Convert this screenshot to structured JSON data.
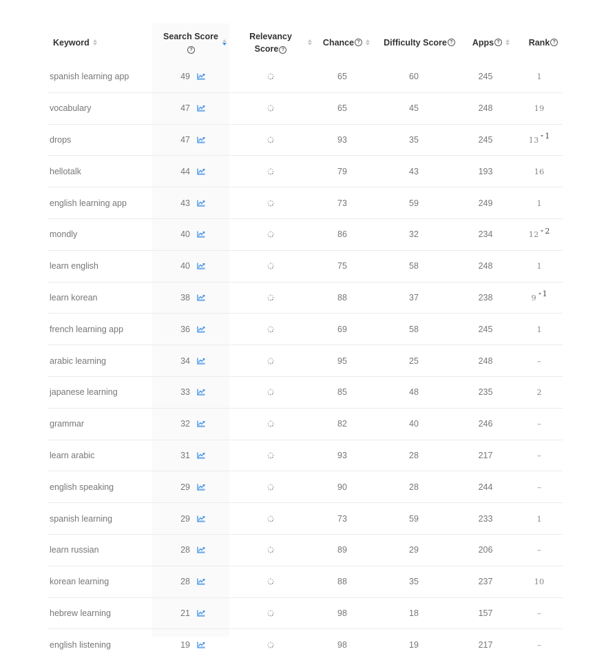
{
  "columns": {
    "keyword": "Keyword",
    "search_score": "Search Score",
    "relevancy_line1": "Relevancy",
    "relevancy_line2": "Score",
    "chance": "Chance",
    "difficulty": "Difficulty Score",
    "apps": "Apps",
    "rank": "Rank",
    "help_glyph": "?"
  },
  "colors": {
    "accent": "#3a8ee6",
    "sticky_bg": "#fafafa"
  },
  "icons": {
    "trend": "line-chart-icon",
    "relevancy": "loading-spinner-icon",
    "sort": "sort-icon",
    "help": "help-circle-icon"
  },
  "rows": [
    {
      "keyword": "spanish learning app",
      "search_score": "49",
      "chance": "65",
      "difficulty": "60",
      "apps": "245",
      "rank": "1",
      "rank_change": ""
    },
    {
      "keyword": "vocabulary",
      "search_score": "47",
      "chance": "65",
      "difficulty": "45",
      "apps": "248",
      "rank": "19",
      "rank_change": ""
    },
    {
      "keyword": "drops",
      "search_score": "47",
      "chance": "93",
      "difficulty": "35",
      "apps": "245",
      "rank": "13",
      "rank_change": "1"
    },
    {
      "keyword": "hellotalk",
      "search_score": "44",
      "chance": "79",
      "difficulty": "43",
      "apps": "193",
      "rank": "16",
      "rank_change": ""
    },
    {
      "keyword": "english learning app",
      "search_score": "43",
      "chance": "73",
      "difficulty": "59",
      "apps": "249",
      "rank": "1",
      "rank_change": ""
    },
    {
      "keyword": "mondly",
      "search_score": "40",
      "chance": "86",
      "difficulty": "32",
      "apps": "234",
      "rank": "12",
      "rank_change": "2"
    },
    {
      "keyword": "learn english",
      "search_score": "40",
      "chance": "75",
      "difficulty": "58",
      "apps": "248",
      "rank": "1",
      "rank_change": ""
    },
    {
      "keyword": "learn korean",
      "search_score": "38",
      "chance": "88",
      "difficulty": "37",
      "apps": "238",
      "rank": "9",
      "rank_change": "1"
    },
    {
      "keyword": "french learning app",
      "search_score": "36",
      "chance": "69",
      "difficulty": "58",
      "apps": "245",
      "rank": "1",
      "rank_change": ""
    },
    {
      "keyword": "arabic learning",
      "search_score": "34",
      "chance": "95",
      "difficulty": "25",
      "apps": "248",
      "rank": "–",
      "rank_change": ""
    },
    {
      "keyword": "japanese learning",
      "search_score": "33",
      "chance": "85",
      "difficulty": "48",
      "apps": "235",
      "rank": "2",
      "rank_change": ""
    },
    {
      "keyword": "grammar",
      "search_score": "32",
      "chance": "82",
      "difficulty": "40",
      "apps": "246",
      "rank": "–",
      "rank_change": ""
    },
    {
      "keyword": "learn arabic",
      "search_score": "31",
      "chance": "93",
      "difficulty": "28",
      "apps": "217",
      "rank": "–",
      "rank_change": ""
    },
    {
      "keyword": "english speaking",
      "search_score": "29",
      "chance": "90",
      "difficulty": "28",
      "apps": "244",
      "rank": "–",
      "rank_change": ""
    },
    {
      "keyword": "spanish learning",
      "search_score": "29",
      "chance": "73",
      "difficulty": "59",
      "apps": "233",
      "rank": "1",
      "rank_change": ""
    },
    {
      "keyword": "learn russian",
      "search_score": "28",
      "chance": "89",
      "difficulty": "29",
      "apps": "206",
      "rank": "–",
      "rank_change": ""
    },
    {
      "keyword": "korean learning",
      "search_score": "28",
      "chance": "88",
      "difficulty": "35",
      "apps": "237",
      "rank": "10",
      "rank_change": ""
    },
    {
      "keyword": "hebrew learning",
      "search_score": "21",
      "chance": "98",
      "difficulty": "18",
      "apps": "157",
      "rank": "–",
      "rank_change": ""
    },
    {
      "keyword": "english listening",
      "search_score": "19",
      "chance": "98",
      "difficulty": "19",
      "apps": "217",
      "rank": "–",
      "rank_change": ""
    }
  ]
}
